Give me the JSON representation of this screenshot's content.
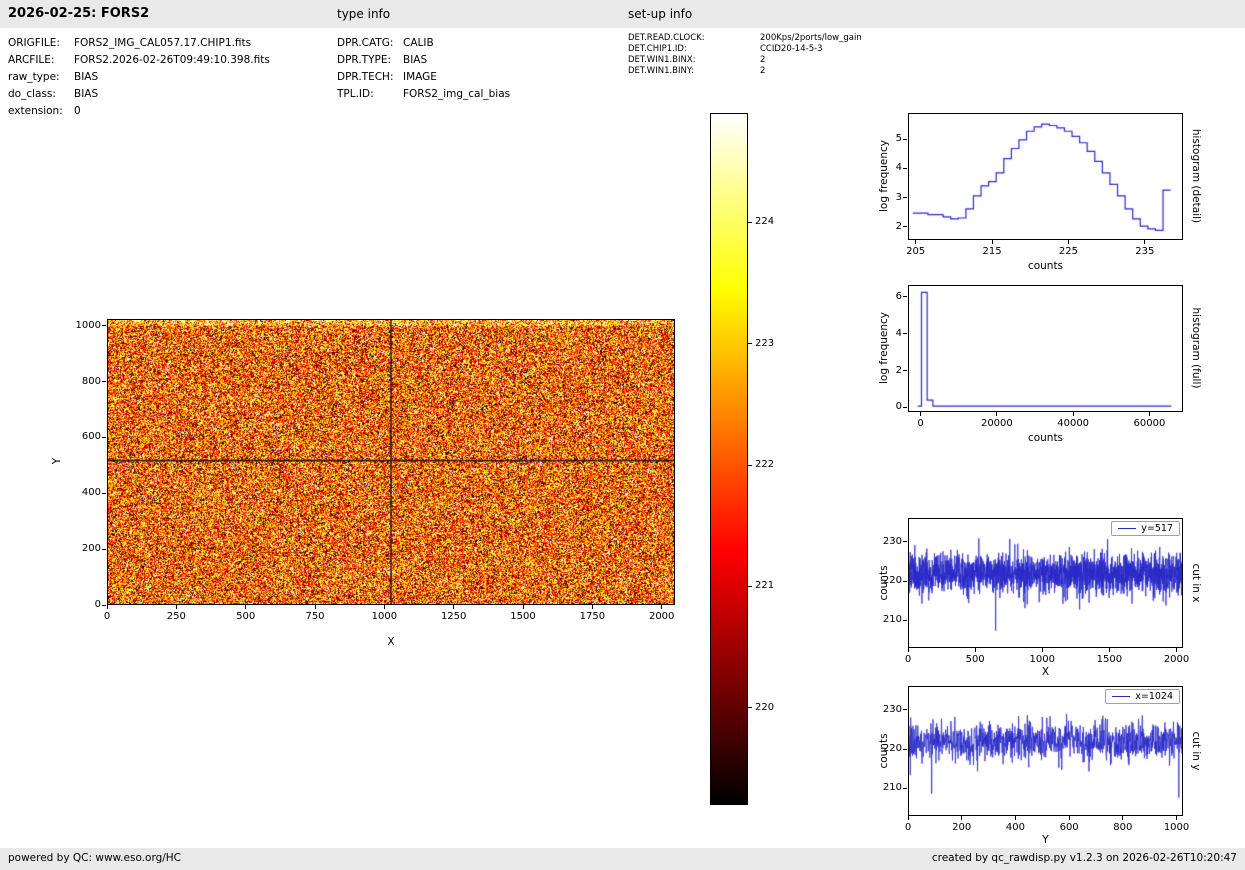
{
  "header": {
    "title": "2026-02-25: FORS2",
    "type_info_label": "type info",
    "setup_info_label": "set-up info"
  },
  "file_info": {
    "rows": [
      {
        "label": "ORIGFILE:",
        "value": "FORS2_IMG_CAL057.17.CHIP1.fits"
      },
      {
        "label": "ARCFILE:",
        "value": "FORS2.2026-02-26T09:49:10.398.fits"
      },
      {
        "label": "raw_type:",
        "value": "BIAS"
      },
      {
        "label": "do_class:",
        "value": "BIAS"
      },
      {
        "label": "extension:",
        "value": "0"
      }
    ]
  },
  "type_info": {
    "rows": [
      {
        "label": "DPR.CATG:",
        "value": "CALIB"
      },
      {
        "label": "DPR.TYPE:",
        "value": "BIAS"
      },
      {
        "label": "DPR.TECH:",
        "value": "IMAGE"
      },
      {
        "label": "TPL.ID:",
        "value": "FORS2_img_cal_bias"
      }
    ]
  },
  "setup_info": {
    "rows": [
      {
        "label": "DET.READ.CLOCK:",
        "value": "200Kps/2ports/low_gain"
      },
      {
        "label": "DET.CHIP1.ID:",
        "value": "CCID20-14-5-3"
      },
      {
        "label": "DET.WIN1.BINX:",
        "value": "2"
      },
      {
        "label": "DET.WIN1.BINY:",
        "value": "2"
      }
    ]
  },
  "footer": {
    "left": "powered by QC: www.eso.org/HC",
    "right": "created by qc_rawdisp.py v1.2.3 on 2026-02-26T10:20:47"
  },
  "chart_data": [
    {
      "id": "bias_image",
      "type": "heatmap",
      "xlabel": "X",
      "ylabel": "Y",
      "xlim": [
        0,
        2048
      ],
      "ylim": [
        0,
        1024
      ],
      "xticks": [
        0,
        250,
        500,
        750,
        1000,
        1250,
        1500,
        1750,
        2000
      ],
      "yticks": [
        0,
        200,
        400,
        600,
        800,
        1000
      ],
      "colormap": "hot",
      "value_range": [
        219.2,
        224.9
      ],
      "noise_mean": 222.1,
      "noise_std": 1.6,
      "seed": 12345,
      "top_strip": {
        "rows_frac": 0.02,
        "mean_offset": 0.9
      },
      "crosshair": {
        "x": 1024,
        "y": 517
      },
      "crosshair_color": "#0b0b2e",
      "colorbar": {
        "ticks": [
          220,
          221,
          222,
          223,
          224
        ]
      }
    },
    {
      "id": "histogram_detail",
      "type": "step",
      "xlabel": "counts",
      "ylabel": "log frequency",
      "right_label": "histogram (detail)",
      "xlim": [
        204,
        240
      ],
      "ylim": [
        1.55,
        5.9
      ],
      "xticks": [
        205,
        215,
        225,
        235
      ],
      "yticks": [
        2,
        3,
        4,
        5
      ],
      "line_color": "#2a2ac8",
      "bin_start": 204.5,
      "bin_width": 1,
      "values": [
        2.45,
        2.45,
        2.4,
        2.4,
        2.32,
        2.25,
        2.28,
        2.6,
        3.05,
        3.4,
        3.55,
        3.85,
        4.35,
        4.7,
        5.0,
        5.3,
        5.45,
        5.55,
        5.5,
        5.42,
        5.3,
        5.12,
        4.9,
        4.6,
        4.25,
        3.85,
        3.45,
        3.05,
        2.6,
        2.25,
        2.0,
        1.9,
        1.85,
        3.25
      ]
    },
    {
      "id": "histogram_full",
      "type": "step",
      "xlabel": "counts",
      "ylabel": "log frequency",
      "right_label": "histogram (full)",
      "xlim": [
        -3300,
        68800
      ],
      "ylim": [
        -0.25,
        6.65
      ],
      "xticks": [
        0,
        20000,
        40000,
        60000
      ],
      "yticks": [
        0,
        2,
        4,
        6
      ],
      "line_color": "#2a2ac8",
      "bin_edges": [
        -1000,
        0,
        1500,
        3000,
        66000
      ],
      "values": [
        0.02,
        6.3,
        0.35,
        0.02
      ]
    },
    {
      "id": "cut_x",
      "type": "line",
      "legend": "y=517",
      "xlabel": "X",
      "ylabel": "counts",
      "right_label": "cut in x",
      "xlim": [
        0,
        2048
      ],
      "ylim": [
        203,
        236
      ],
      "xticks": [
        0,
        500,
        1000,
        1500,
        2000
      ],
      "yticks": [
        210,
        220,
        230
      ],
      "line_color": "#2a2ac8",
      "noise": {
        "n": 2048,
        "mean": 221.8,
        "std": 2.6,
        "seed": 77
      },
      "outliers": [
        {
          "x": 650,
          "v": 207.2
        },
        {
          "x": 1490,
          "v": 230.8
        }
      ]
    },
    {
      "id": "cut_y",
      "type": "line",
      "legend": "x=1024",
      "xlabel": "Y",
      "ylabel": "counts",
      "right_label": "cut in y",
      "xlim": [
        0,
        1024
      ],
      "ylim": [
        203,
        236
      ],
      "xticks": [
        0,
        200,
        400,
        600,
        800,
        1000
      ],
      "yticks": [
        210,
        220,
        230
      ],
      "line_color": "#2a2ac8",
      "noise": {
        "n": 1024,
        "mean": 222.0,
        "std": 2.6,
        "seed": 99
      },
      "outliers": [
        {
          "x": 85,
          "v": 208.5
        },
        {
          "x": 1012,
          "v": 207.5
        }
      ]
    }
  ]
}
